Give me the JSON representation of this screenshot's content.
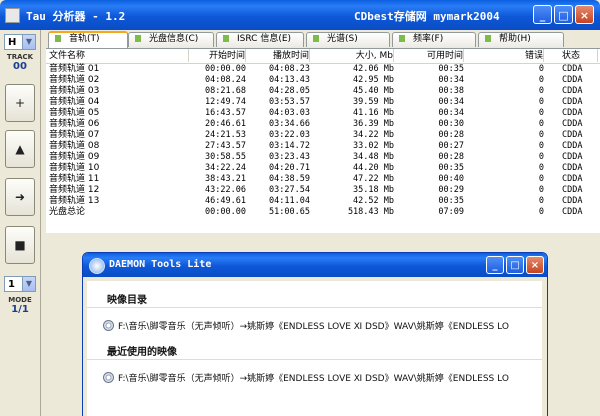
{
  "window": {
    "title": "Tau 分析器 - 1.2",
    "extra_title": "CDbest存储网 mymark2004",
    "minimize": "_",
    "maximize": "□",
    "close": "×"
  },
  "left_panel": {
    "track_select": "H",
    "track_label": "TRACK",
    "track_value": "00",
    "buttons": [
      "+",
      "▲",
      "➜",
      "■"
    ],
    "mode_select": "1",
    "mode_label": "MODE",
    "mode_value": "1/1"
  },
  "tabs": [
    {
      "label": "音轨(T)",
      "active": true
    },
    {
      "label": "光盘信息(C)",
      "active": false
    },
    {
      "label": "ISRC 信息(E)",
      "active": false
    },
    {
      "label": "光谱(S)",
      "active": false
    },
    {
      "label": "频率(F)",
      "active": false
    },
    {
      "label": "帮助(H)",
      "active": false
    }
  ],
  "table": {
    "columns": [
      "文件名称",
      "开始时间",
      "播放时间",
      "大小, Mb",
      "可用时间",
      "错误",
      "状态"
    ],
    "rows": [
      [
        "音频轨道 01",
        "00:00.00",
        "04:08.23",
        "42.06 Mb",
        "00:35",
        "0",
        "CDDA"
      ],
      [
        "音频轨道 02",
        "04:08.24",
        "04:13.43",
        "42.95 Mb",
        "00:34",
        "0",
        "CDDA"
      ],
      [
        "音频轨道 03",
        "08:21.68",
        "04:28.05",
        "45.40 Mb",
        "00:38",
        "0",
        "CDDA"
      ],
      [
        "音频轨道 04",
        "12:49.74",
        "03:53.57",
        "39.59 Mb",
        "00:34",
        "0",
        "CDDA"
      ],
      [
        "音频轨道 05",
        "16:43.57",
        "04:03.03",
        "41.16 Mb",
        "00:34",
        "0",
        "CDDA"
      ],
      [
        "音频轨道 06",
        "20:46.61",
        "03:34.66",
        "36.39 Mb",
        "00:30",
        "0",
        "CDDA"
      ],
      [
        "音频轨道 07",
        "24:21.53",
        "03:22.03",
        "34.22 Mb",
        "00:28",
        "0",
        "CDDA"
      ],
      [
        "音频轨道 08",
        "27:43.57",
        "03:14.72",
        "33.02 Mb",
        "00:27",
        "0",
        "CDDA"
      ],
      [
        "音频轨道 09",
        "30:58.55",
        "03:23.43",
        "34.48 Mb",
        "00:28",
        "0",
        "CDDA"
      ],
      [
        "音频轨道 10",
        "34:22.24",
        "04:20.71",
        "44.20 Mb",
        "00:35",
        "0",
        "CDDA"
      ],
      [
        "音频轨道 11",
        "38:43.21",
        "04:38.59",
        "47.22 Mb",
        "00:40",
        "0",
        "CDDA"
      ],
      [
        "音频轨道 12",
        "43:22.06",
        "03:27.54",
        "35.18 Mb",
        "00:29",
        "0",
        "CDDA"
      ],
      [
        "音频轨道 13",
        "46:49.61",
        "04:11.04",
        "42.52 Mb",
        "00:35",
        "0",
        "CDDA"
      ]
    ],
    "total": [
      "光盘总论",
      "00:00.00",
      "51:00.65",
      "518.43 Mb",
      "07:09",
      "0",
      "CDDA"
    ]
  },
  "daemon": {
    "title": "DAEMON Tools Lite",
    "image_section": "映像目录",
    "image_item": "F:\\音乐\\脚零音乐（无声倾听）→姚斯婷《ENDLESS LOVE Ⅺ DSD》WAV\\姚斯婷《ENDLESS LO",
    "recent_section": "最近使用的映像",
    "recent_item": "F:\\音乐\\脚零音乐（无声倾听）→姚斯婷《ENDLESS LOVE Ⅺ DSD》WAV\\姚斯婷《ENDLESS LO"
  }
}
